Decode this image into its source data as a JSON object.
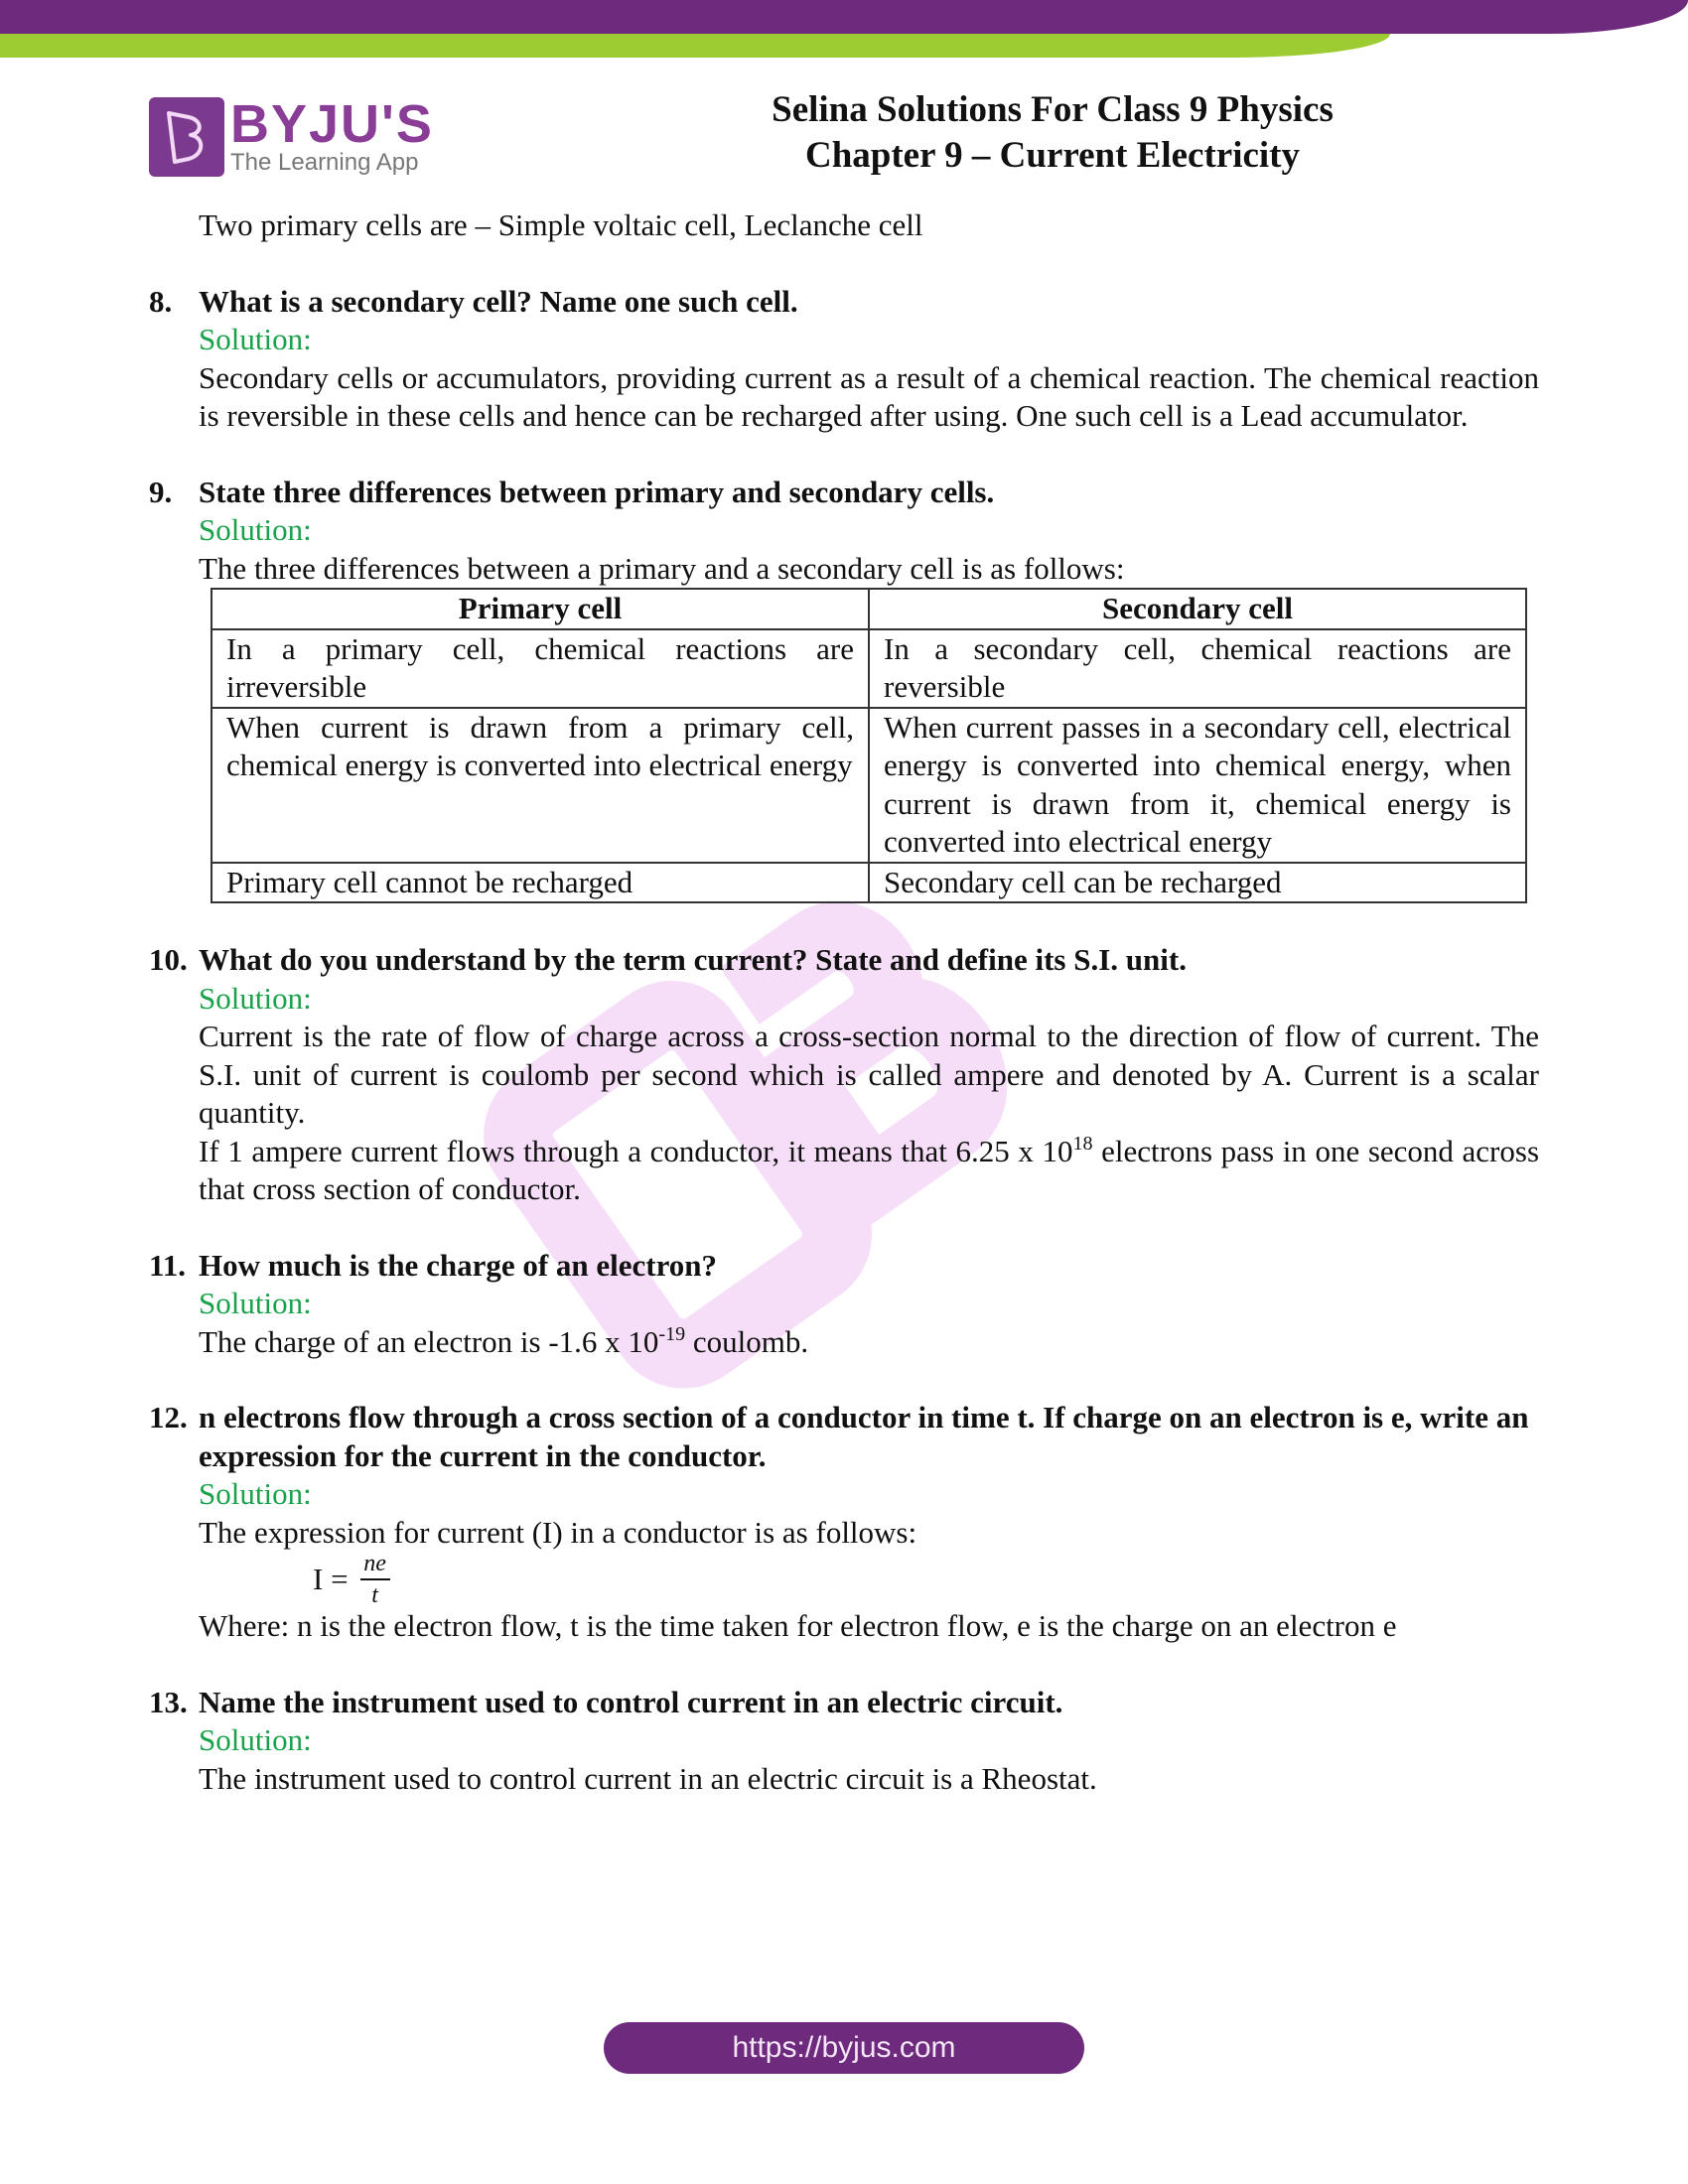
{
  "header": {
    "logo_main": "BYJU'S",
    "logo_sub": "The Learning App",
    "title_line1": "Selina Solutions For Class 9 Physics",
    "title_line2": "Chapter 9 – Current Electricity",
    "brand_purple": "#6e2a7c",
    "brand_green": "#9ccb32"
  },
  "intro": "Two primary cells are – Simple voltaic cell, Leclanche cell",
  "solution_label": "Solution:",
  "solution_color": "#1aa24b",
  "questions": [
    {
      "num": "8.",
      "text": "What is a secondary cell? Name one such cell.",
      "answer": "Secondary cells or accumulators, providing current as a result of a chemical reaction. The chemical reaction is reversible in these cells and hence can be recharged after using. One such cell is a Lead accumulator."
    },
    {
      "num": "9.",
      "text": "State three differences between primary and secondary cells.",
      "answer": "The three differences between a primary and a secondary cell is as follows:",
      "table": {
        "headers": [
          "Primary cell",
          "Secondary cell"
        ],
        "rows": [
          [
            "In a primary cell, chemical reactions are irreversible",
            "In a secondary cell, chemical reactions are reversible"
          ],
          [
            "When current is drawn from a primary cell, chemical energy is converted into electrical energy",
            "When current passes in a secondary cell, electrical energy is converted into chemical energy, when current is drawn from it, chemical energy is converted into electrical energy"
          ],
          [
            "Primary cell cannot be recharged",
            "Secondary cell can be recharged"
          ]
        ]
      }
    },
    {
      "num": "10.",
      "text": "What do you understand by the term current? State and define its S.I. unit.",
      "answer_lines": [
        "Current is the rate of flow of charge across a cross-section normal to the direction of flow of current. The S.I. unit of current is coulomb per second which is called ampere and denoted by A. Current is a scalar quantity."
      ],
      "answer2_pre": "If 1 ampere current flows through a conductor, it means that 6.25 x 10",
      "answer2_sup": "18",
      "answer2_post": " electrons pass in one second across that cross section of conductor."
    },
    {
      "num": "11.",
      "text": "How much is the charge of an electron?",
      "answer_pre": "The charge of an electron is -1.6 x 10",
      "answer_sup": "-19",
      "answer_post": " coulomb."
    },
    {
      "num": "12.",
      "text": "n electrons flow through a cross section of a conductor in time t. If charge on an electron is e, write an expression for the current in the conductor.",
      "answer": "The expression for current (I) in a conductor is as follows:",
      "formula_lhs": "I =",
      "formula_num": "ne",
      "formula_den": "t",
      "where": "Where: n is the electron flow, t is the time taken for electron flow, e is the charge on an electron e"
    },
    {
      "num": "13.",
      "text": "Name the instrument used to control current in an electric circuit.",
      "answer": "The instrument used to control current in an electric circuit is a Rheostat."
    }
  ],
  "footer": {
    "url": "https://byjus.com"
  }
}
